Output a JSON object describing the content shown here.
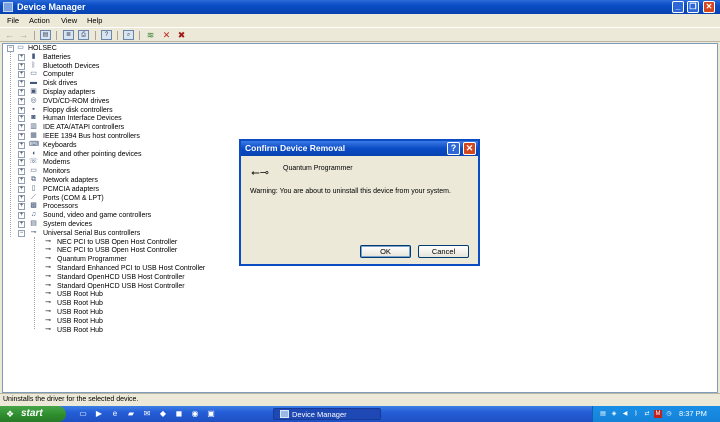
{
  "window": {
    "title": "Device Manager",
    "controls": {
      "minimize": "_",
      "restore": "❐",
      "close": "✕"
    }
  },
  "menu": [
    "File",
    "Action",
    "View",
    "Help"
  ],
  "tree": {
    "root": "HOLSEC",
    "categories": [
      {
        "label": "Batteries",
        "icon": "battery-icon",
        "expanded": false
      },
      {
        "label": "Bluetooth Devices",
        "icon": "bluetooth-icon",
        "expanded": false
      },
      {
        "label": "Computer",
        "icon": "computer-icon",
        "expanded": false
      },
      {
        "label": "Disk drives",
        "icon": "disk-drive-icon",
        "expanded": false
      },
      {
        "label": "Display adapters",
        "icon": "display-adapter-icon",
        "expanded": false
      },
      {
        "label": "DVD/CD-ROM drives",
        "icon": "dvd-drive-icon",
        "expanded": false
      },
      {
        "label": "Floppy disk controllers",
        "icon": "floppy-controller-icon",
        "expanded": false
      },
      {
        "label": "Human Interface Devices",
        "icon": "hid-icon",
        "expanded": false
      },
      {
        "label": "IDE ATA/ATAPI controllers",
        "icon": "ide-controller-icon",
        "expanded": false
      },
      {
        "label": "IEEE 1394 Bus host controllers",
        "icon": "ieee1394-icon",
        "expanded": false
      },
      {
        "label": "Keyboards",
        "icon": "keyboard-icon",
        "expanded": false
      },
      {
        "label": "Mice and other pointing devices",
        "icon": "mouse-icon",
        "expanded": false
      },
      {
        "label": "Modems",
        "icon": "modem-icon",
        "expanded": false
      },
      {
        "label": "Monitors",
        "icon": "monitor-icon",
        "expanded": false
      },
      {
        "label": "Network adapters",
        "icon": "network-adapter-icon",
        "expanded": false
      },
      {
        "label": "PCMCIA adapters",
        "icon": "pcmcia-icon",
        "expanded": false
      },
      {
        "label": "Ports (COM & LPT)",
        "icon": "port-icon",
        "expanded": false
      },
      {
        "label": "Processors",
        "icon": "processor-icon",
        "expanded": false
      },
      {
        "label": "Sound, video and game controllers",
        "icon": "sound-icon",
        "expanded": false
      },
      {
        "label": "System devices",
        "icon": "system-device-icon",
        "expanded": false
      },
      {
        "label": "Universal Serial Bus controllers",
        "icon": "usb-icon",
        "expanded": true
      }
    ],
    "usb_children": [
      "NEC PCI to USB Open Host Controller",
      "NEC PCI to USB Open Host Controller",
      "Quantum Programmer",
      "Standard Enhanced PCI to USB Host Controller",
      "Standard OpenHCD USB Host Controller",
      "Standard OpenHCD USB Host Controller",
      "USB Root Hub",
      "USB Root Hub",
      "USB Root Hub",
      "USB Root Hub",
      "USB Root Hub"
    ]
  },
  "status_bar": "Uninstalls the driver for the selected device.",
  "dialog": {
    "title": "Confirm Device Removal",
    "help_glyph": "?",
    "close_glyph": "✕",
    "device_name": "Quantum Programmer",
    "warning": "Warning: You are about to uninstall this device from your system.",
    "ok_label": "OK",
    "cancel_label": "Cancel"
  },
  "taskbar": {
    "start_label": "start",
    "task_button_label": "Device Manager",
    "clock": "8:37 PM"
  },
  "colors": {
    "titlebar_blue": "#0a4cc4",
    "start_green": "#2c8c2c",
    "close_red": "#d4461f"
  }
}
